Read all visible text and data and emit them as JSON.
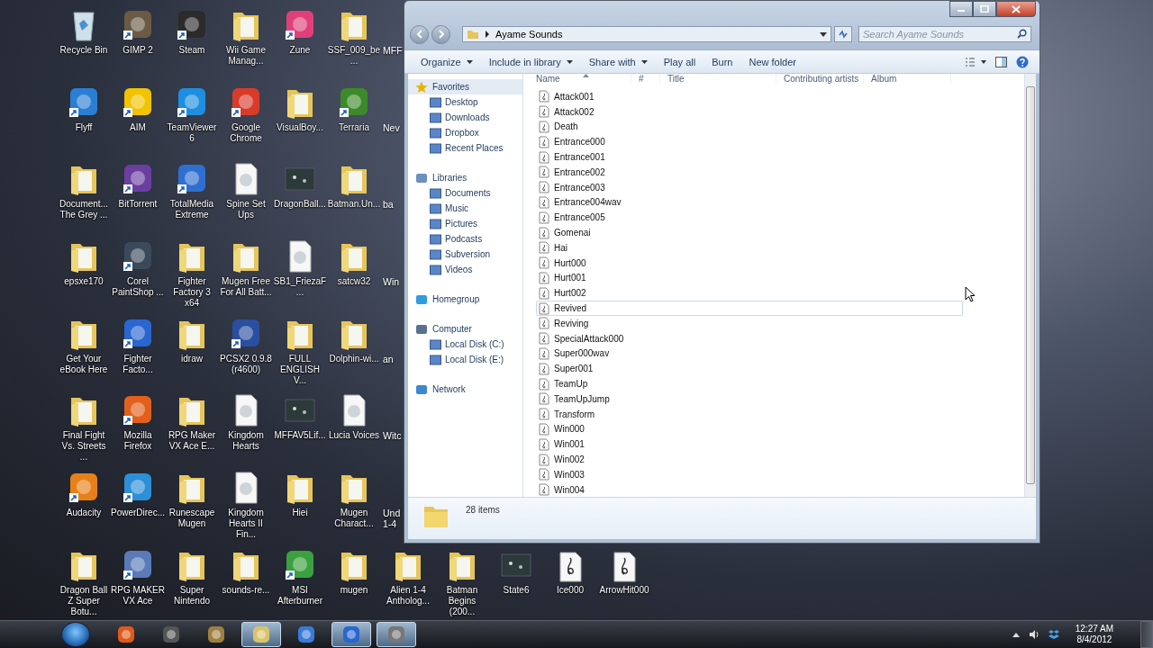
{
  "desktop_icons": [
    {
      "label": "Recycle Bin",
      "kind": "recycle-bin",
      "shortcut": false
    },
    {
      "label": "Flyff",
      "kind": "app",
      "color": "#2a7fd4",
      "shortcut": true
    },
    {
      "label": "Document... The Grey ...",
      "kind": "folder",
      "shortcut": false
    },
    {
      "label": "epsxe170",
      "kind": "folder",
      "shortcut": false
    },
    {
      "label": "Get Your eBook Here",
      "kind": "folder",
      "shortcut": false
    },
    {
      "label": "Final Fight Vs. Streets ...",
      "kind": "folder",
      "shortcut": false
    },
    {
      "label": "Audacity",
      "kind": "app",
      "color": "#e8801a",
      "shortcut": true
    },
    {
      "label": "Dragon Ball Z Super Botu...",
      "kind": "folder",
      "shortcut": false
    },
    {
      "label": "GIMP 2",
      "kind": "app",
      "color": "#6b5b45",
      "shortcut": true
    },
    {
      "label": "AIM",
      "kind": "app",
      "color": "#f2c300",
      "shortcut": true
    },
    {
      "label": "BitTorrent",
      "kind": "app",
      "color": "#6a3fa0",
      "shortcut": true
    },
    {
      "label": "Corel PaintShop ...",
      "kind": "app",
      "color": "#3a4a5a",
      "shortcut": true
    },
    {
      "label": "Fighter Facto...",
      "kind": "app",
      "color": "#2a66d0",
      "shortcut": true
    },
    {
      "label": "Mozilla Firefox",
      "kind": "app",
      "color": "#e2601c",
      "shortcut": true
    },
    {
      "label": "PowerDirec...",
      "kind": "app",
      "color": "#2d8fd8",
      "shortcut": true
    },
    {
      "label": "RPG MAKER VX Ace",
      "kind": "app",
      "color": "#5a7ab8",
      "shortcut": true
    },
    {
      "label": "Steam",
      "kind": "app",
      "color": "#2b2b2b",
      "shortcut": true
    },
    {
      "label": "TeamViewer 6",
      "kind": "app",
      "color": "#1e8fe0",
      "shortcut": true
    },
    {
      "label": "TotalMedia Extreme",
      "kind": "app",
      "color": "#2f6fd0",
      "shortcut": true
    },
    {
      "label": "Fighter Factory 3 x64",
      "kind": "folder",
      "shortcut": false
    },
    {
      "label": "idraw",
      "kind": "folder",
      "shortcut": false
    },
    {
      "label": "RPG Maker VX Ace E...",
      "kind": "folder",
      "shortcut": false
    },
    {
      "label": "Runescape Mugen",
      "kind": "folder",
      "shortcut": false
    },
    {
      "label": "Super Nintendo",
      "kind": "folder",
      "shortcut": false
    },
    {
      "label": "Wii Game Manag...",
      "kind": "folder",
      "shortcut": false
    },
    {
      "label": "Google Chrome",
      "kind": "app",
      "color": "#d93b2b",
      "shortcut": true
    },
    {
      "label": "Spine Set Ups",
      "kind": "document",
      "shortcut": false
    },
    {
      "label": "Mugen Free For All Batt...",
      "kind": "folder",
      "shortcut": false
    },
    {
      "label": "PCSX2 0.9.8 (r4600)",
      "kind": "app",
      "color": "#2a4fa0",
      "shortcut": true
    },
    {
      "label": "Kingdom Hearts",
      "kind": "document",
      "shortcut": false
    },
    {
      "label": "Kingdom Hearts II Fin...",
      "kind": "document",
      "shortcut": false
    },
    {
      "label": "sounds-re...",
      "kind": "folder",
      "shortcut": false
    },
    {
      "label": "Zune",
      "kind": "app",
      "color": "#e0407a",
      "shortcut": true
    },
    {
      "label": "VisualBoy...",
      "kind": "folder",
      "shortcut": false
    },
    {
      "label": "DragonBall...",
      "kind": "image",
      "shortcut": false
    },
    {
      "label": "SB1_FriezaF...",
      "kind": "document",
      "shortcut": false
    },
    {
      "label": "FULL ENGLISH V...",
      "kind": "folder",
      "shortcut": false
    },
    {
      "label": "MFFAV5Lif...",
      "kind": "image",
      "shortcut": false
    },
    {
      "label": "Hiei",
      "kind": "folder",
      "shortcut": false
    },
    {
      "label": "MSI Afterburner",
      "kind": "app",
      "color": "#3aa040",
      "shortcut": true
    },
    {
      "label": "SSF_009_be...",
      "kind": "folder",
      "shortcut": false
    },
    {
      "label": "Terraria",
      "kind": "app",
      "color": "#3d8a2a",
      "shortcut": true
    },
    {
      "label": "Batman.Un...",
      "kind": "folder",
      "shortcut": false
    },
    {
      "label": "satcw32",
      "kind": "folder",
      "shortcut": false
    },
    {
      "label": "Dolphin-wi...",
      "kind": "folder",
      "shortcut": false
    },
    {
      "label": "Lucia Voices",
      "kind": "document",
      "shortcut": false
    },
    {
      "label": "Mugen Charact...",
      "kind": "folder",
      "shortcut": false
    },
    {
      "label": "mugen",
      "kind": "folder",
      "shortcut": false
    }
  ],
  "desktop_icons_partly_hidden": [
    "MFF",
    "Nev",
    "ba",
    "Win",
    "an",
    "Witc",
    "Und 1-4"
  ],
  "desktop_icons_bottom_row": [
    {
      "label": "Alien 1-4 Antholog...",
      "kind": "folder",
      "shortcut": false
    },
    {
      "label": "Batman Begins (200...",
      "kind": "folder",
      "shortcut": false
    },
    {
      "label": "State6",
      "kind": "image",
      "shortcut": false
    },
    {
      "label": "Ice000",
      "kind": "audio",
      "shortcut": false
    },
    {
      "label": "ArrowHit000",
      "kind": "audio",
      "shortcut": false
    }
  ],
  "explorer": {
    "address": "Ayame Sounds",
    "search": {
      "placeholder": "Search Ayame Sounds"
    },
    "toolbar": [
      {
        "label": "Organize",
        "has_menu": true
      },
      {
        "label": "Include in library",
        "has_menu": true
      },
      {
        "label": "Share with",
        "has_menu": true
      },
      {
        "label": "Play all",
        "has_menu": false
      },
      {
        "label": "Burn",
        "has_menu": false
      },
      {
        "label": "New folder",
        "has_menu": false
      }
    ],
    "nav": [
      {
        "label": "Favorites",
        "selected": true,
        "children": [
          {
            "label": "Desktop",
            "selected": false
          },
          {
            "label": "Downloads",
            "selected": false
          },
          {
            "label": "Dropbox",
            "selected": false
          },
          {
            "label": "Recent Places",
            "selected": false
          }
        ]
      },
      {
        "label": "Libraries",
        "selected": false,
        "children": [
          {
            "label": "Documents",
            "selected": false
          },
          {
            "label": "Music",
            "selected": false
          },
          {
            "label": "Pictures",
            "selected": false
          },
          {
            "label": "Podcasts",
            "selected": false
          },
          {
            "label": "Subversion",
            "selected": false
          },
          {
            "label": "Videos",
            "selected": false
          }
        ]
      },
      {
        "label": "Homegroup",
        "selected": false
      },
      {
        "label": "Computer",
        "selected": false,
        "children": [
          {
            "label": "Local Disk (C:)",
            "selected": false
          },
          {
            "label": "Local Disk (E:)",
            "selected": false
          }
        ]
      },
      {
        "label": "Network",
        "selected": false
      }
    ],
    "columns": [
      "Name",
      "#",
      "Title",
      "Contributing artists",
      "Album"
    ],
    "files": [
      {
        "name": "Attack001",
        "selected": false
      },
      {
        "name": "Attack002",
        "selected": false
      },
      {
        "name": "Death",
        "selected": false
      },
      {
        "name": "Entrance000",
        "selected": false
      },
      {
        "name": "Entrance001",
        "selected": false
      },
      {
        "name": "Entrance002",
        "selected": false
      },
      {
        "name": "Entrance003",
        "selected": false
      },
      {
        "name": "Entrance004wav",
        "selected": false
      },
      {
        "name": "Entrance005",
        "selected": false
      },
      {
        "name": "Gomenai",
        "selected": false
      },
      {
        "name": "Hai",
        "selected": false
      },
      {
        "name": "Hurt000",
        "selected": false
      },
      {
        "name": "Hurt001",
        "selected": false
      },
      {
        "name": "Hurt002",
        "selected": false
      },
      {
        "name": "Revived",
        "selected": true
      },
      {
        "name": "Reviving",
        "selected": false
      },
      {
        "name": "SpecialAttack000",
        "selected": false
      },
      {
        "name": "Super000wav",
        "selected": false
      },
      {
        "name": "Super001",
        "selected": false
      },
      {
        "name": "TeamUp",
        "selected": false
      },
      {
        "name": "TeamUpJump",
        "selected": false
      },
      {
        "name": "Transform",
        "selected": false
      },
      {
        "name": "Win000",
        "selected": false
      },
      {
        "name": "Win001",
        "selected": false
      },
      {
        "name": "Win002",
        "selected": false
      },
      {
        "name": "Win003",
        "selected": false
      },
      {
        "name": "Win004",
        "selected": false
      }
    ],
    "item_count": "28 items"
  },
  "taskbar": [
    {
      "active": false
    },
    {
      "active": false
    },
    {
      "active": false
    },
    {
      "active": true
    },
    {
      "active": false
    },
    {
      "active": true
    },
    {
      "active": true
    }
  ],
  "clock": {
    "time": "12:27 AM",
    "date": "8/4/2012"
  }
}
